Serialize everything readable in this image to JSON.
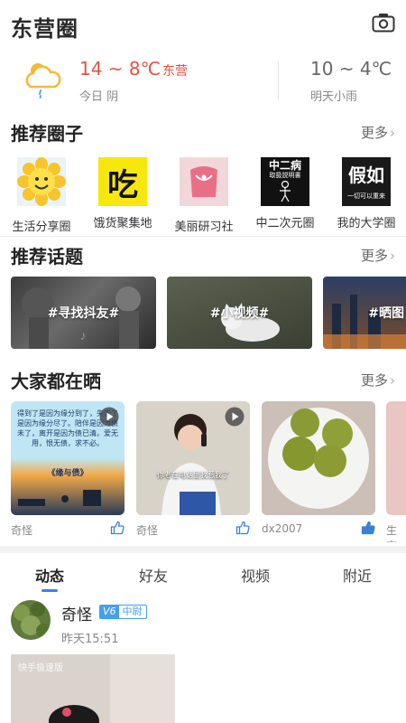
{
  "header": {
    "title": "东营圈",
    "camera_icon": "camera-icon"
  },
  "weather": {
    "today_temp": "14 ~ 8℃",
    "city": "东营",
    "today_desc": "今日 阴",
    "tomorrow_temp": "10 ~ 4℃",
    "tomorrow_desc": "明天小雨",
    "icon": "cloud-rain-icon"
  },
  "circles": {
    "title": "推荐圈子",
    "more": "更多",
    "items": [
      {
        "label": "生活分享圈"
      },
      {
        "label": "饿货聚集地",
        "thumb_text": "吃"
      },
      {
        "label": "美丽研习社"
      },
      {
        "label": "中二次元圈",
        "thumb_text": "中二病",
        "thumb_sub": "取扱説明書"
      },
      {
        "label": "我的大学圈",
        "thumb_text": "假如",
        "thumb_sub": "一切可以重来"
      }
    ]
  },
  "topics": {
    "title": "推荐话题",
    "more": "更多",
    "items": [
      {
        "label": "#寻找抖友#"
      },
      {
        "label": "#小视频#"
      },
      {
        "label": "#晒图"
      }
    ]
  },
  "shares": {
    "title": "大家都在晒",
    "more": "更多",
    "items": [
      {
        "user": "奇怪",
        "caption": "得到了是因为缘分到了，失去了是因为缘分尽了。陪伴是因为债未了，离开是因为债已清。爱无用，恨无债，求不必。",
        "tag": "《缘与债》"
      },
      {
        "user": "奇怪",
        "caption": "你老在电话里我惹我了"
      },
      {
        "user": "dx2007"
      },
      {
        "user": "生态"
      }
    ]
  },
  "tabs": [
    "动态",
    "好友",
    "视频",
    "附近"
  ],
  "post": {
    "name": "奇怪",
    "level": "V6",
    "rank": "中尉",
    "time": "昨天15:51",
    "watermark": "快手极速版"
  }
}
